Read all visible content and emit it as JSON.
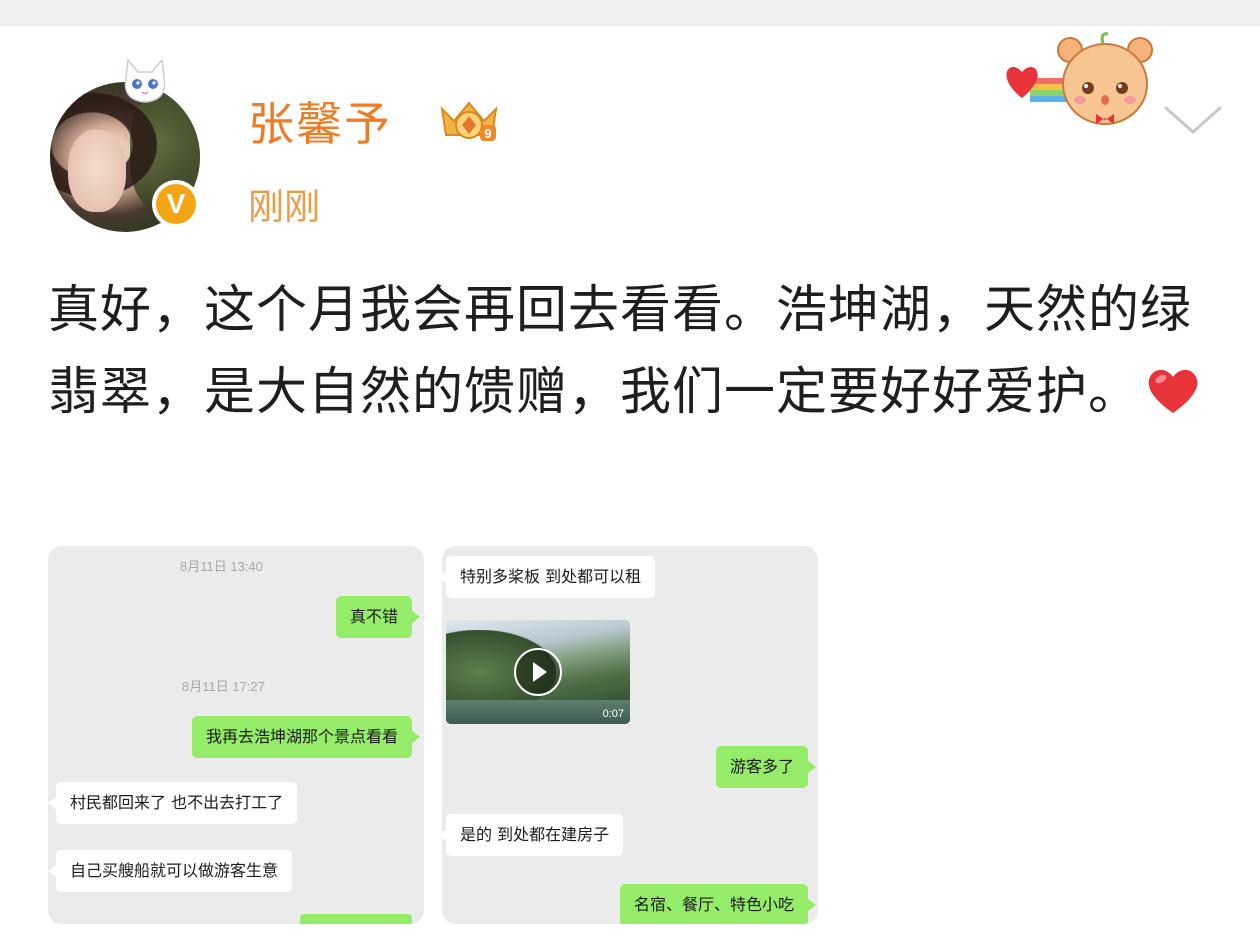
{
  "post": {
    "username": "张馨予",
    "timestamp": "刚刚",
    "verified_badge": "V",
    "text": "真好，这个月我会再回去看看。浩坤湖，天然的绿翡翠，是大自然的馈赠，我们一定要好好爱护。",
    "text_emoji": "heart-emoji",
    "icons": [
      "cat-avatar-decoration",
      "crown-level-icon",
      "bear-rainbow-heart-sticker",
      "chevron-down-icon"
    ]
  },
  "colors": {
    "username": "#f07b25",
    "timestamp": "#f19a45",
    "verified": "#f3a514",
    "chat_bg": "#ebebeb",
    "bubble_out": "#95ec69",
    "bubble_in": "#ffffff"
  },
  "images": [
    {
      "messages": [
        {
          "type": "time",
          "text": "8月11日 13:40"
        },
        {
          "type": "out",
          "text": "真不错"
        },
        {
          "type": "time",
          "text": "8月11日 17:27"
        },
        {
          "type": "out",
          "text": "我再去浩坤湖那个景点看看"
        },
        {
          "type": "in",
          "text": "村民都回来了 也不出去打工了"
        },
        {
          "type": "in",
          "text": "自己买艘船就可以做游客生意"
        }
      ]
    },
    {
      "messages": [
        {
          "type": "in",
          "text": "特别多桨板 到处都可以租"
        },
        {
          "type": "video",
          "duration": "0:07"
        },
        {
          "type": "out",
          "text": "游客多了"
        },
        {
          "type": "in",
          "text": "是的 到处都在建房子"
        },
        {
          "type": "out",
          "text": "名宿、餐厅、特色小吃"
        }
      ]
    }
  ]
}
